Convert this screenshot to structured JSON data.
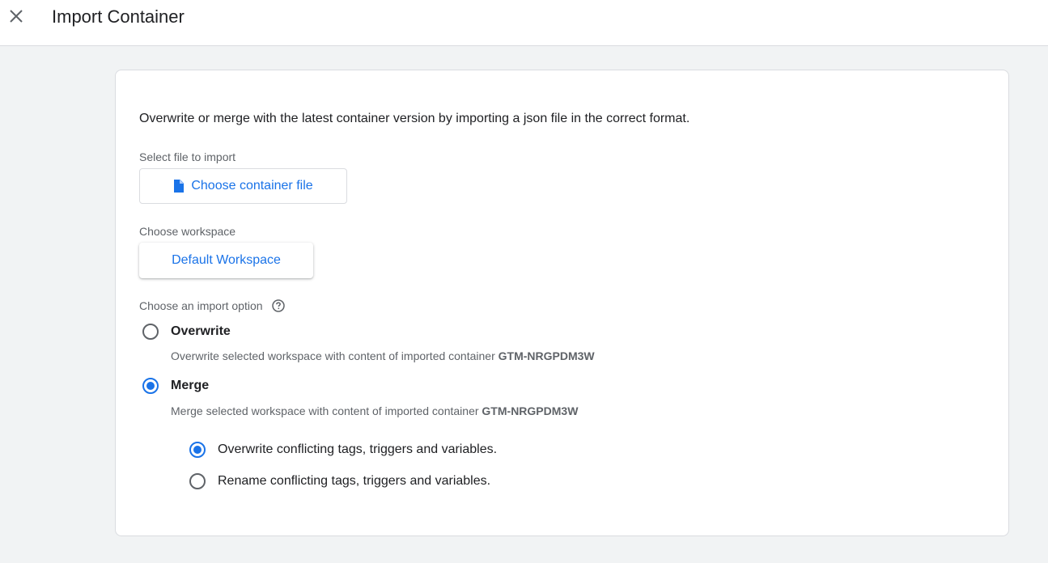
{
  "header": {
    "title": "Import Container",
    "close_icon": "close-icon"
  },
  "main": {
    "description": "Overwrite or merge with the latest container version by importing a json file in the correct format.",
    "file": {
      "label": "Select file to import",
      "button_label": "Choose container file",
      "icon": "file-icon"
    },
    "workspace": {
      "label": "Choose workspace",
      "button_label": "Default Workspace"
    },
    "import_option": {
      "label": "Choose an import option",
      "help_icon": "help-circle-icon",
      "options": [
        {
          "title": "Overwrite",
          "description": "Overwrite selected workspace with content of imported container",
          "container_id": "GTM-NRGPDM3W",
          "selected": false
        },
        {
          "title": "Merge",
          "description": "Merge selected workspace with content of imported container",
          "container_id": "GTM-NRGPDM3W",
          "selected": true
        }
      ],
      "merge_options": [
        {
          "label": "Overwrite conflicting tags, triggers and variables.",
          "selected": true
        },
        {
          "label": "Rename conflicting tags, triggers and variables.",
          "selected": false
        }
      ]
    }
  },
  "colors": {
    "accent": "#1a73e8",
    "background": "#f1f3f4",
    "text": "#202124",
    "secondary_text": "#5f6368"
  }
}
